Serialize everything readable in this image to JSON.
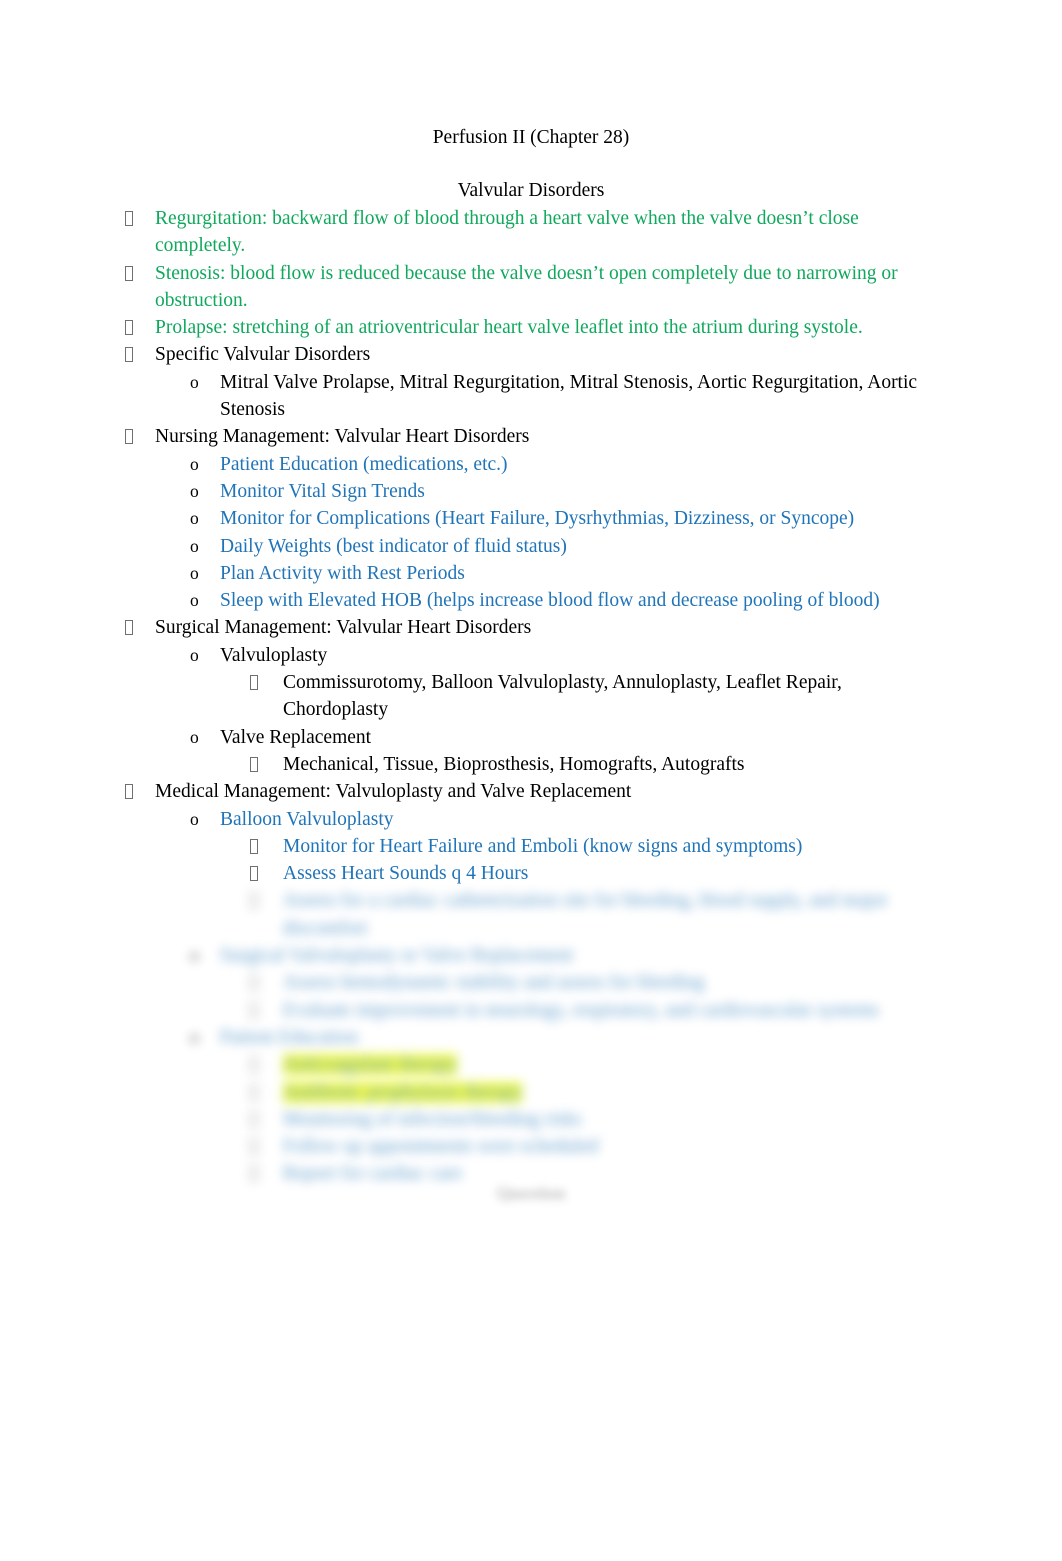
{
  "document": {
    "title": "Perfusion II (Chapter 28)",
    "subtitle": "Valvular Disorders",
    "colors": {
      "green": "#0FA85C",
      "blue": "#2074B8",
      "black": "#000000",
      "highlight_yellow": "#EAF703",
      "page_background": "#FFFFFF"
    }
  },
  "outline": [
    {
      "level": 1,
      "marker": "box-bullet-glyph",
      "color": "green",
      "text": "Regurgitation:  backward flow of blood through a heart valve when the valve doesn’t close completely."
    },
    {
      "level": 1,
      "marker": "box-bullet-glyph",
      "color": "green",
      "text": "Stenosis:  blood flow is reduced because the valve doesn’t open completely due to narrowing or obstruction."
    },
    {
      "level": 1,
      "marker": "box-bullet-glyph",
      "color": "green",
      "text": "Prolapse:  stretching of an atrioventricular heart valve leaflet into the atrium during systole."
    },
    {
      "level": 1,
      "marker": "box-bullet-glyph",
      "color": "black",
      "text": "Specific Valvular Disorders"
    },
    {
      "level": 2,
      "marker": "o",
      "color": "black",
      "text": "Mitral Valve Prolapse, Mitral Regurgitation, Mitral Stenosis, Aortic Regurgitation, Aortic Stenosis"
    },
    {
      "level": 1,
      "marker": "box-bullet-glyph",
      "color": "black",
      "text": "Nursing Management: Valvular Heart Disorders"
    },
    {
      "level": 2,
      "marker": "o",
      "color": "blue",
      "text": "Patient Education (medications, etc.)"
    },
    {
      "level": 2,
      "marker": "o",
      "color": "blue",
      "text": "Monitor Vital Sign Trends"
    },
    {
      "level": 2,
      "marker": "o",
      "color": "blue",
      "text": "Monitor for Complications (Heart Failure, Dysrhythmias, Dizziness, or Syncope)"
    },
    {
      "level": 2,
      "marker": "o",
      "color": "blue",
      "text": "Daily Weights (best indicator of fluid status)"
    },
    {
      "level": 2,
      "marker": "o",
      "color": "blue",
      "text": "Plan Activity with Rest Periods"
    },
    {
      "level": 2,
      "marker": "o",
      "color": "blue",
      "text": "Sleep with Elevated HOB (helps increase blood flow and decrease pooling of blood)"
    },
    {
      "level": 1,
      "marker": "box-bullet-glyph",
      "color": "black",
      "text": "Surgical Management: Valvular Heart Disorders"
    },
    {
      "level": 2,
      "marker": "o",
      "color": "black",
      "text": "Valvuloplasty"
    },
    {
      "level": 3,
      "marker": "box-bullet-glyph",
      "color": "black",
      "text": "Commissurotomy, Balloon Valvuloplasty, Annuloplasty, Leaflet Repair, Chordoplasty"
    },
    {
      "level": 2,
      "marker": "o",
      "color": "black",
      "text": "Valve Replacement"
    },
    {
      "level": 3,
      "marker": "box-bullet-glyph",
      "color": "black",
      "text": "Mechanical, Tissue, Bioprosthesis, Homografts, Autografts"
    },
    {
      "level": 1,
      "marker": "box-bullet-glyph",
      "color": "black",
      "text": "Medical Management: Valvuloplasty and Valve Replacement"
    },
    {
      "level": 2,
      "marker": "o",
      "color": "blue",
      "text": "Balloon Valvuloplasty"
    },
    {
      "level": 3,
      "marker": "box-bullet-glyph",
      "color": "blue",
      "text": "Monitor for Heart Failure and Emboli (know signs and symptoms)"
    },
    {
      "level": 3,
      "marker": "box-bullet-glyph",
      "color": "blue",
      "text": "Assess Heart Sounds q 4 Hours"
    }
  ],
  "redacted_region": {
    "note": "Lower portion of the page is blurred and illegible.",
    "lines": [
      {
        "level": 3,
        "marker": "box-bullet-glyph",
        "color": "blue",
        "highlighted": false,
        "text": "Assess for a cardiac catheterization site for bleeding, blood supply, and major discomfort"
      },
      {
        "level": 2,
        "marker": "o",
        "color": "blue",
        "highlighted": false,
        "text": "Surgical Valvuloplasty or Valve Replacement"
      },
      {
        "level": 3,
        "marker": "box-bullet-glyph",
        "color": "blue",
        "highlighted": false,
        "text": "Assess hemodynamic stability and assess for bleeding"
      },
      {
        "level": 3,
        "marker": "box-bullet-glyph",
        "color": "blue",
        "highlighted": false,
        "text": "Evaluate improvement in neurology, respiratory, and cardiovascular systems"
      },
      {
        "level": 2,
        "marker": "o",
        "color": "blue",
        "highlighted": false,
        "text": "Patient Education"
      },
      {
        "level": 3,
        "marker": "box-bullet-glyph",
        "color": "blue",
        "highlighted": true,
        "text": "Anticoagulant therapy"
      },
      {
        "level": 3,
        "marker": "box-bullet-glyph",
        "color": "blue",
        "highlighted": true,
        "text": "Antibiotic prophylaxis therapy"
      },
      {
        "level": 3,
        "marker": "box-bullet-glyph",
        "color": "blue",
        "highlighted": false,
        "text": "Monitoring of infection/bleeding risks"
      },
      {
        "level": 3,
        "marker": "box-bullet-glyph",
        "color": "blue",
        "highlighted": false,
        "text": "Follow up appointments were scheduled"
      },
      {
        "level": 3,
        "marker": "box-bullet-glyph",
        "color": "blue",
        "highlighted": false,
        "text": "Report for cardiac care"
      }
    ],
    "footer_text": "Question"
  }
}
